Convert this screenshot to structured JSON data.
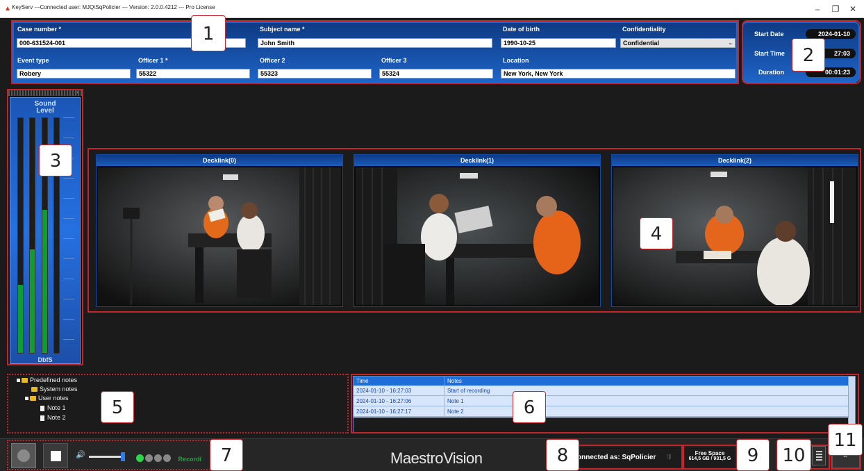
{
  "window": {
    "title": "KeyServ ---Connected user: MJQ\\SqPolicier --- Version: 2.0.0.4212 --- Pro License",
    "minimize_glyph": "–",
    "maximize_glyph": "❐",
    "close_glyph": "✕"
  },
  "form": {
    "case_number": {
      "label": "Case number *",
      "value": "000-631524-001"
    },
    "subject_name": {
      "label": "Subject name *",
      "value": "John Smith"
    },
    "date_of_birth": {
      "label": "Date of birth",
      "value": "1990-10-25"
    },
    "confidentiality": {
      "label": "Confidentiality",
      "value": "Confidential"
    },
    "event_type": {
      "label": "Event type",
      "value": "Robery"
    },
    "officer1": {
      "label": "Officer 1 *",
      "value": "55322"
    },
    "officer2": {
      "label": "Officer 2",
      "value": "55323"
    },
    "officer3": {
      "label": "Officer 3",
      "value": "55324"
    },
    "location": {
      "label": "Location",
      "value": "New York, New York"
    }
  },
  "session": {
    "start_date": {
      "label": "Start Date",
      "value": "2024-01-10"
    },
    "start_time": {
      "label": "Start Time",
      "value": "27:03"
    },
    "duration": {
      "label": "Duration",
      "value": "00:01:23"
    }
  },
  "sound_meter": {
    "title_line1": "Sound",
    "title_line2": "Level",
    "unit": "DbfS",
    "levels": [
      0.29,
      0.44,
      0.61,
      0.0
    ],
    "colors": {
      "level": "#0d9e2f",
      "panel": "#1e63c6"
    }
  },
  "video": {
    "feeds": [
      {
        "label": "Decklink(0)"
      },
      {
        "label": "Decklink(1)"
      },
      {
        "label": "Decklink(2)"
      }
    ]
  },
  "notes_tree": {
    "root": "Predefined notes",
    "system": "System notes",
    "user": "User notes",
    "note1": "Note 1",
    "note2": "Note 2"
  },
  "notes_table": {
    "headers": [
      "Time",
      "Notes"
    ],
    "rows": [
      {
        "time": "2024-01-10 - 16:27:03",
        "note": "Start of recording"
      },
      {
        "time": "2024-01-10 - 16:27:06",
        "note": "Note 1"
      },
      {
        "time": "2024-01-10 - 16:27:17",
        "note": "Note 2"
      }
    ]
  },
  "bottom": {
    "recording_text": "Recordi",
    "volume": 0.95,
    "brand": "MaestroVision",
    "connected": "onnected as: SqPolicier",
    "free_space_label": "Free Space",
    "free_space_value": "614,5 GB / 931,5 G"
  },
  "annotations": [
    "1",
    "2",
    "3",
    "4",
    "5",
    "6",
    "7",
    "8",
    "9",
    "10",
    "11"
  ],
  "icons": {
    "app": "app-logo-icon",
    "record": "record-icon",
    "stop": "stop-icon",
    "volume": "speaker-icon",
    "tray": "list-icon",
    "expand": "expand-icon"
  }
}
